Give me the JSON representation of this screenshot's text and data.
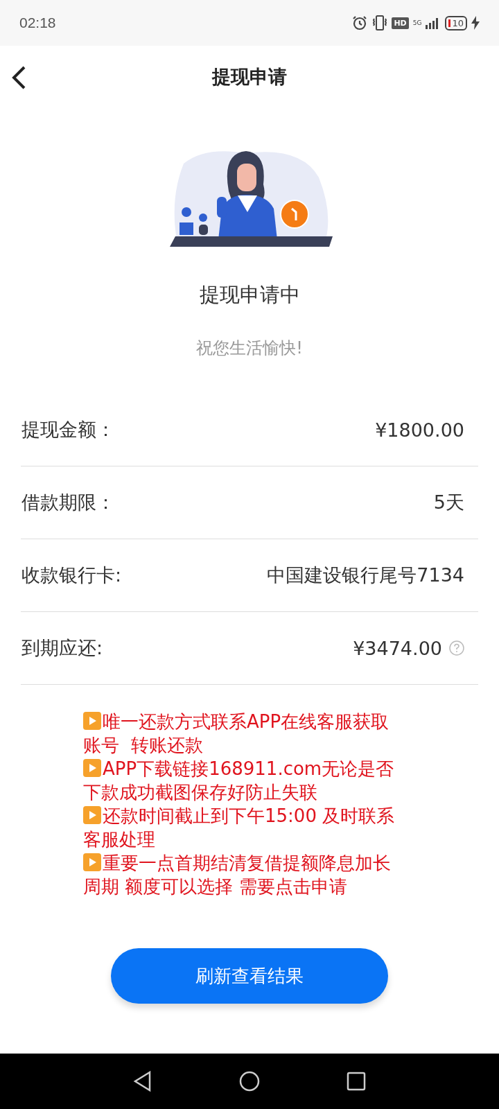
{
  "status_bar": {
    "time": "02:18",
    "hd": "HD",
    "network": "5G",
    "battery": "10"
  },
  "header": {
    "title": "提现申请"
  },
  "status": {
    "title": "提现申请中",
    "subtitle": "祝您生活愉快!"
  },
  "details": [
    {
      "label": "提现金额：",
      "value": "¥1800.00",
      "help": false
    },
    {
      "label": "借款期限：",
      "value": "5天",
      "help": false
    },
    {
      "label": "收款银行卡:",
      "value": "中国建设银行尾号7134",
      "help": false
    },
    {
      "label": "到期应还:",
      "value": "¥3474.00",
      "help": true
    }
  ],
  "notes": [
    "唯一还款方式联系APP在线客服获取账号  转账还款",
    "APP下载链接168911.com无论是否下款成功截图保存好防止失联",
    "还款时间截止到下午15:00 及时联系客服处理",
    "重要一点首期结清复借提额降息加长周期 额度可以选择 需要点击申请"
  ],
  "button": {
    "label": "刷新查看结果"
  }
}
